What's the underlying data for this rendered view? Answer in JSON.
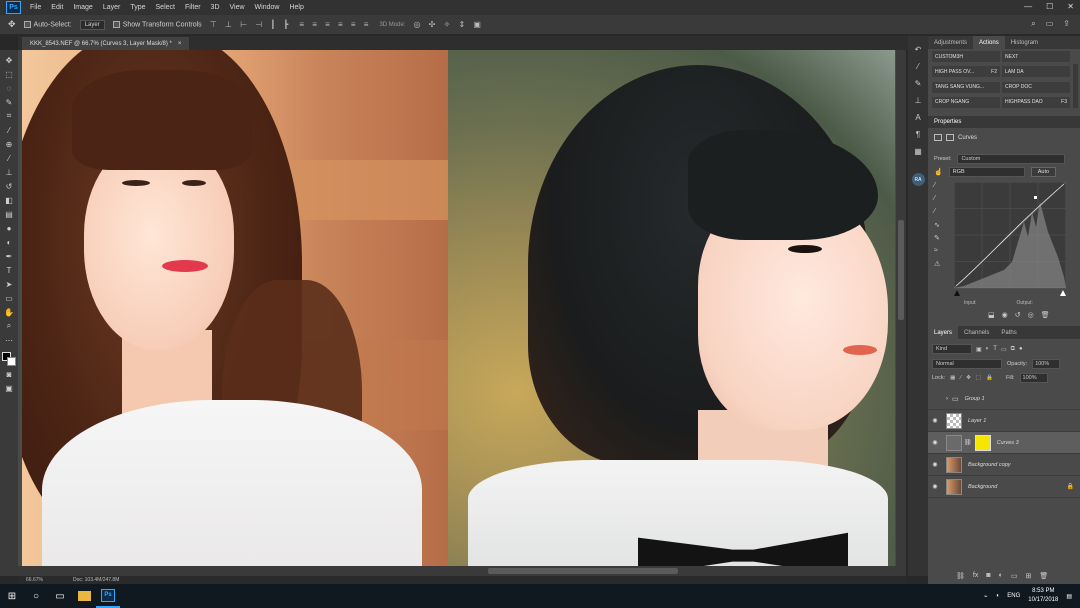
{
  "menu": {
    "app_logo": "Ps",
    "items": [
      "File",
      "Edit",
      "Image",
      "Layer",
      "Type",
      "Select",
      "Filter",
      "3D",
      "View",
      "Window",
      "Help"
    ]
  },
  "options_bar": {
    "auto_select_label": "Auto-Select:",
    "auto_select_value": "Layer",
    "transform_label": "Show Transform Controls",
    "mode_label": "3D Mode:"
  },
  "document_tab": {
    "title": "KKK_8543.NEF @ 66.7% (Curves 3, Layer Mask/8) *",
    "close": "×"
  },
  "status_bar": {
    "zoom": "66.67%",
    "doc": "Doc: 103.4M/247.8M"
  },
  "top_panel_tabs": [
    "Adjustments",
    "Actions",
    "Histogram"
  ],
  "actions": [
    {
      "name": "CUSTOM3H",
      "key": ""
    },
    {
      "name": "NEXT",
      "key": ""
    },
    {
      "name": "HIGH PASS OV...",
      "key": "F2"
    },
    {
      "name": "LAM DA",
      "key": ""
    },
    {
      "name": "TANG SANG VUNG...",
      "key": ""
    },
    {
      "name": "CROP DOC",
      "key": ""
    },
    {
      "name": "CROP NGANG",
      "key": ""
    },
    {
      "name": "HIGHPASS DAO",
      "key": "F3"
    }
  ],
  "properties": {
    "header": "Properties",
    "title": "Curves",
    "preset_label": "Preset:",
    "preset_value": "Custom",
    "channel_value": "RGB",
    "auto_button": "Auto",
    "input_label": "Input:",
    "output_label": "Output:"
  },
  "layers_panel": {
    "tabs": [
      "Layers",
      "Channels",
      "Paths"
    ],
    "filter_value": "Kind",
    "blend_mode": "Normal",
    "opacity_label": "Opacity:",
    "opacity_value": "100%",
    "lock_label": "Lock:",
    "fill_label": "Fill:",
    "fill_value": "100%",
    "layers": [
      {
        "name": "Group 1",
        "type": "group",
        "visible": false,
        "active": false
      },
      {
        "name": "Layer 1",
        "type": "layer",
        "visible": true,
        "active": false
      },
      {
        "name": "Curves 3",
        "type": "adjustment",
        "visible": true,
        "active": true
      },
      {
        "name": "Background copy",
        "type": "layer",
        "visible": true,
        "active": false
      },
      {
        "name": "Background",
        "type": "layer",
        "visible": true,
        "active": false,
        "locked": true
      }
    ]
  },
  "dock": {
    "avatar": "RA"
  },
  "taskbar": {
    "lang": "ENG",
    "time": "8:53 PM",
    "date": "10/17/2018"
  },
  "colors": {
    "accent": "#31a8ff",
    "panel_bg": "#4a4a4a",
    "mask_yellow": "#f5e600"
  }
}
